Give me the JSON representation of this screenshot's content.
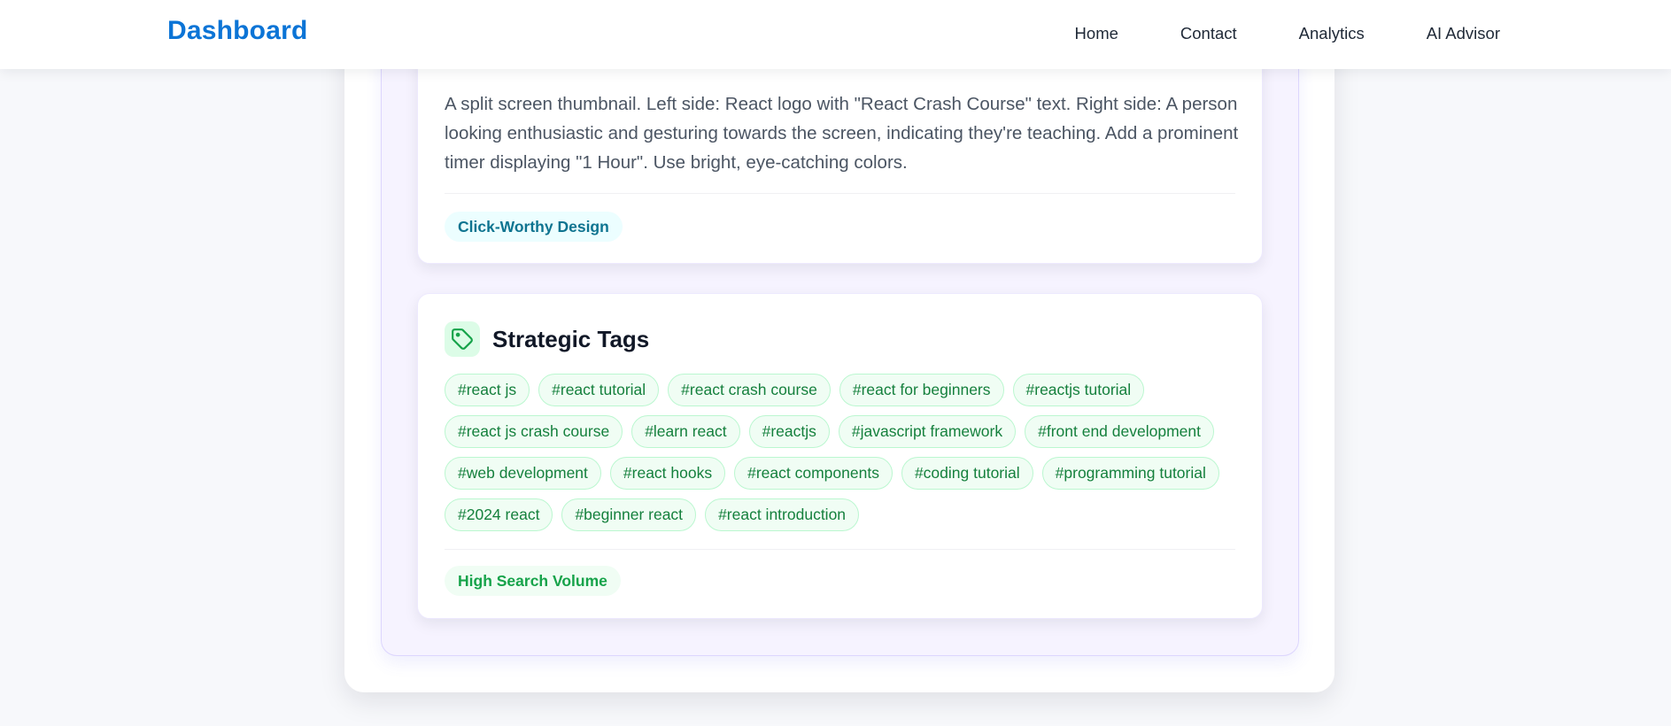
{
  "navbar": {
    "brand": "Dashboard",
    "links": [
      "Home",
      "Contact",
      "Analytics",
      "AI Advisor"
    ]
  },
  "thumbnail_card": {
    "description": "A split screen thumbnail. Left side: React logo with \"React Crash Course\" text. Right side: A person looking enthusiastic and gesturing towards the screen, indicating they're teaching. Add a prominent timer displaying \"1 Hour\". Use bright, eye-catching colors.",
    "badge": "Click-Worthy Design"
  },
  "tags_card": {
    "title": "Strategic Tags",
    "icon": "tag-icon",
    "tags": [
      "#react js",
      "#react tutorial",
      "#react crash course",
      "#react for beginners",
      "#reactjs tutorial",
      "#react js crash course",
      "#learn react",
      "#reactjs",
      "#javascript framework",
      "#front end development",
      "#web development",
      "#react hooks",
      "#react components",
      "#coding tutorial",
      "#programming tutorial",
      "#2024 react",
      "#beginner react",
      "#react introduction"
    ],
    "badge": "High Search Volume"
  },
  "colors": {
    "brand": "#0b74d6",
    "tag_green": "#15803d",
    "badge_cyan": "#0e7490",
    "panel_lavender": "#f6f3ff"
  }
}
